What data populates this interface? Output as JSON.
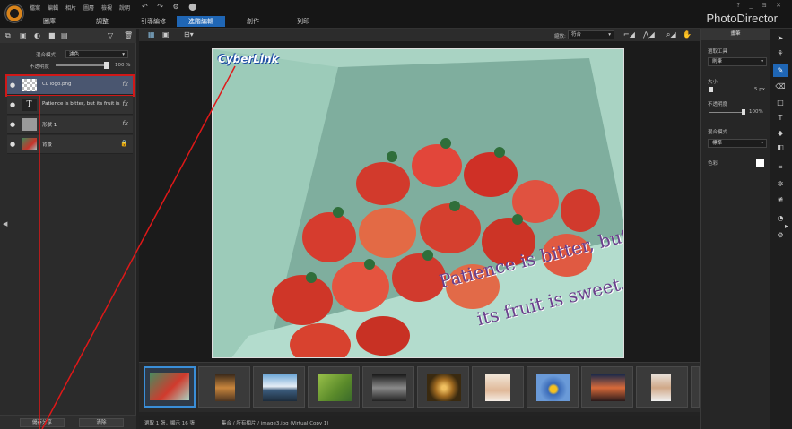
{
  "menu": [
    "檔案",
    "編輯",
    "相片",
    "圖層",
    "檢視",
    "說明"
  ],
  "modes": [
    "圖庫",
    "調整",
    "引導編修",
    "進階編輯",
    "創作",
    "列印"
  ],
  "active_mode": "進階編輯",
  "brand": "PhotoDirector",
  "window_controls": "? _ ⊟ ✕",
  "toolbar_icons": "↶ ↷ ⚙ ⬤",
  "left_panel": {
    "blend_label": "混合模式：",
    "blend_value": "濾色",
    "opacity_label": "不透明度",
    "opacity_value": "100 %",
    "opacity": 1.0,
    "layers": [
      {
        "name": "CL logo.png",
        "type": "image",
        "selected": true
      },
      {
        "name": "Patience is bitter, but its fruit is swe...",
        "type": "text",
        "selected": false
      },
      {
        "name": "形狀 1",
        "type": "shape",
        "selected": false
      },
      {
        "name": "背景",
        "type": "background",
        "selected": false
      }
    ],
    "btn_merge": "儲存分享",
    "btn_clear": "清除"
  },
  "canvas_toolbar": {
    "zoom_label": "縮放:",
    "zoom_value": "符合"
  },
  "photo": {
    "logo_text": "CyberLink",
    "caption_line1": "Patience is bitter, but",
    "caption_line2": "its fruit is sweet."
  },
  "filmstrip_count": 11,
  "status": {
    "left": "選取 1 張，顯示 16 張",
    "path": "集合 / 所有相片 / image3.jpg (Virtual Copy 1)"
  },
  "right_panel": {
    "header": "畫筆",
    "tool_label": "選取工具",
    "tool_value": "刷筆",
    "size_label": "大小",
    "size_value": "5 px",
    "opacity_label": "不透明度",
    "opacity_value": "100%",
    "blend_label": "混合模式",
    "blend_value": "標準",
    "color_label": "色彩"
  },
  "colors": {
    "accent": "#1f66b5",
    "highlight_red": "#d01818"
  }
}
